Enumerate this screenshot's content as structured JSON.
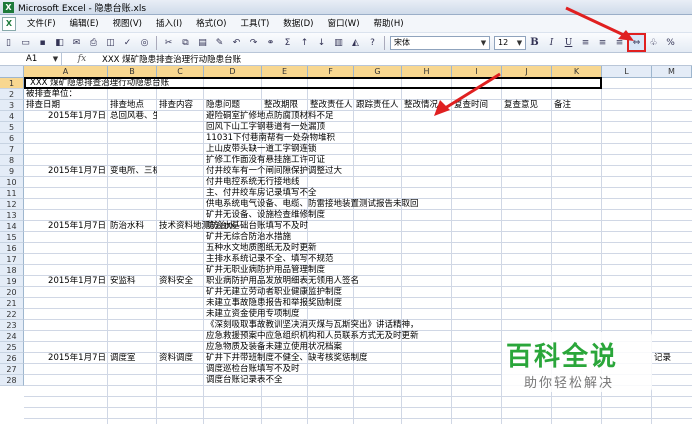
{
  "window": {
    "title": "Microsoft Excel - 隐患台账.xls"
  },
  "menu": [
    "文件(F)",
    "编辑(E)",
    "视图(V)",
    "插入(I)",
    "格式(O)",
    "工具(T)",
    "数据(D)",
    "窗口(W)",
    "帮助(H)"
  ],
  "toolbar": {
    "font": "宋体",
    "size": "12",
    "bold": "B",
    "italic": "I",
    "underline": "U",
    "percent": "%"
  },
  "formula": {
    "namebox": "A1",
    "fx": "fx",
    "value": "XXX 煤矿隐患排查治理行动隐患台账"
  },
  "columns": [
    "A",
    "B",
    "C",
    "D",
    "E",
    "F",
    "G",
    "H",
    "I",
    "J",
    "K",
    "L",
    "M"
  ],
  "rows": [
    "1",
    "2",
    "3",
    "4",
    "5",
    "6",
    "7",
    "8",
    "9",
    "10",
    "11",
    "12",
    "13",
    "14",
    "15",
    "16",
    "17",
    "18",
    "19",
    "20",
    "21",
    "22",
    "23",
    "24",
    "25",
    "26",
    "27",
    "28"
  ],
  "cells": {
    "r1": "XXX 煤矿隐患排查治理行动隐患台账",
    "r2": "被排查单位：",
    "headers": [
      "排查日期",
      "排查地点",
      "排查内容",
      "隐患问题",
      "整改期限",
      "整改责任人",
      "跟踪责任人",
      "整改情况",
      "复查时间",
      "复查意见",
      "备注"
    ],
    "dates": [
      "2015年1月7日",
      "2015年1月7日",
      "2015年1月7日",
      "2015年1月7日",
      "2015年1月7日"
    ],
    "places": [
      "总回风巷、生产",
      "变电所、三机电",
      "防治水科",
      "安监科",
      "调度室"
    ],
    "contents": [
      "",
      "",
      "技术资料地测防治水",
      "资料安全",
      "资料调度"
    ],
    "issues": [
      "避险硐室扩修地点防腐顶材料不足",
      "回风下山工字钢巷道有一处漏顶",
      "11031下付巷南帮有一处杂物堆积",
      "上山皮带头缺一道工字钢连锁",
      "扩修工作面没有悬挂施工许可证",
      "付井绞车有一个闸间隙保护调整过大",
      "付井电控系统无行接地线",
      "主、付井绞车房记录填写不全",
      "供电系统电气设备、电缆、防雷接地装置测试报告未取回",
      "矿井无设备、设施检查维修制度",
      "防治水基础台账填写不及时",
      "矿井无综合防治水措施",
      "五种水文地质图纸无及时更新",
      "主排水系统记录不全、填写不规范",
      "矿井无职业病防护用品管理制度",
      "职业病防护用品发放明细表无领用人签名",
      "矿井无建立劳动者职业健康监护制度",
      "未建立事故隐患报告和举报奖励制度",
      "未建立资金使用专项制度",
      "《深刻吸取事故教训坚决消灭煤与瓦斯突出》讲话精神，",
      "应急救援预案中应急组织机构和人员联系方式无及时更新",
      "应急物质及装备未建立使用状况档案",
      "矿井下井带班制度不健全、缺考核奖惩制度",
      "调度巡检台账填写不及时",
      "调度台账记录表不全"
    ],
    "note": "记录"
  },
  "watermark": {
    "logo": "百科全说",
    "sub": "助你轻松解决"
  },
  "colors": {
    "accent": "#e02020",
    "header_bg": "#e4ecf7",
    "select": "#f8d790"
  }
}
